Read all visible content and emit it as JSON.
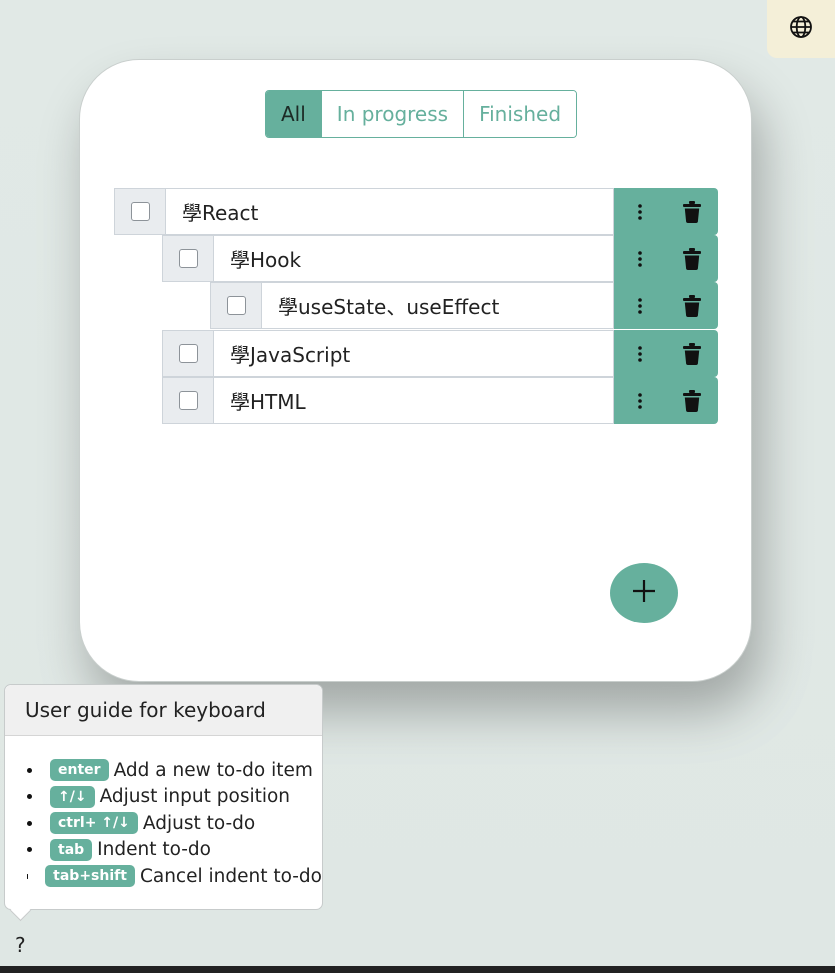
{
  "language_button": {
    "icon": "globe-icon"
  },
  "filters": [
    {
      "label": "All",
      "active": true
    },
    {
      "label": "In progress",
      "active": false
    },
    {
      "label": "Finished",
      "active": false
    }
  ],
  "todos": [
    {
      "text": "學React",
      "indent": 0,
      "checked": false
    },
    {
      "text": "學Hook",
      "indent": 1,
      "checked": false
    },
    {
      "text": "學useState、useEffect",
      "indent": 2,
      "checked": false
    },
    {
      "text": "學JavaScript",
      "indent": 1,
      "checked": false
    },
    {
      "text": "學HTML",
      "indent": 1,
      "checked": false
    }
  ],
  "row_actions": {
    "menu_icon": "kebab-menu-icon",
    "delete_icon": "trash-icon"
  },
  "add_button": {
    "icon": "plus-icon"
  },
  "guide": {
    "title": "User guide for keyboard",
    "items": [
      {
        "key": "enter",
        "desc": "Add a new to-do item"
      },
      {
        "key": "↑/↓",
        "desc": "Adjust input position"
      },
      {
        "key": "ctrl+ ↑/↓",
        "desc": "Adjust to-do"
      },
      {
        "key": "tab",
        "desc": "Indent to-do"
      },
      {
        "key": "tab+shift",
        "desc": "Cancel indent to-do"
      }
    ]
  },
  "help_button": {
    "label": "?"
  },
  "colors": {
    "accent": "#66b09d",
    "lang_bg": "#f4efd8",
    "background": "#e1e9e6"
  }
}
